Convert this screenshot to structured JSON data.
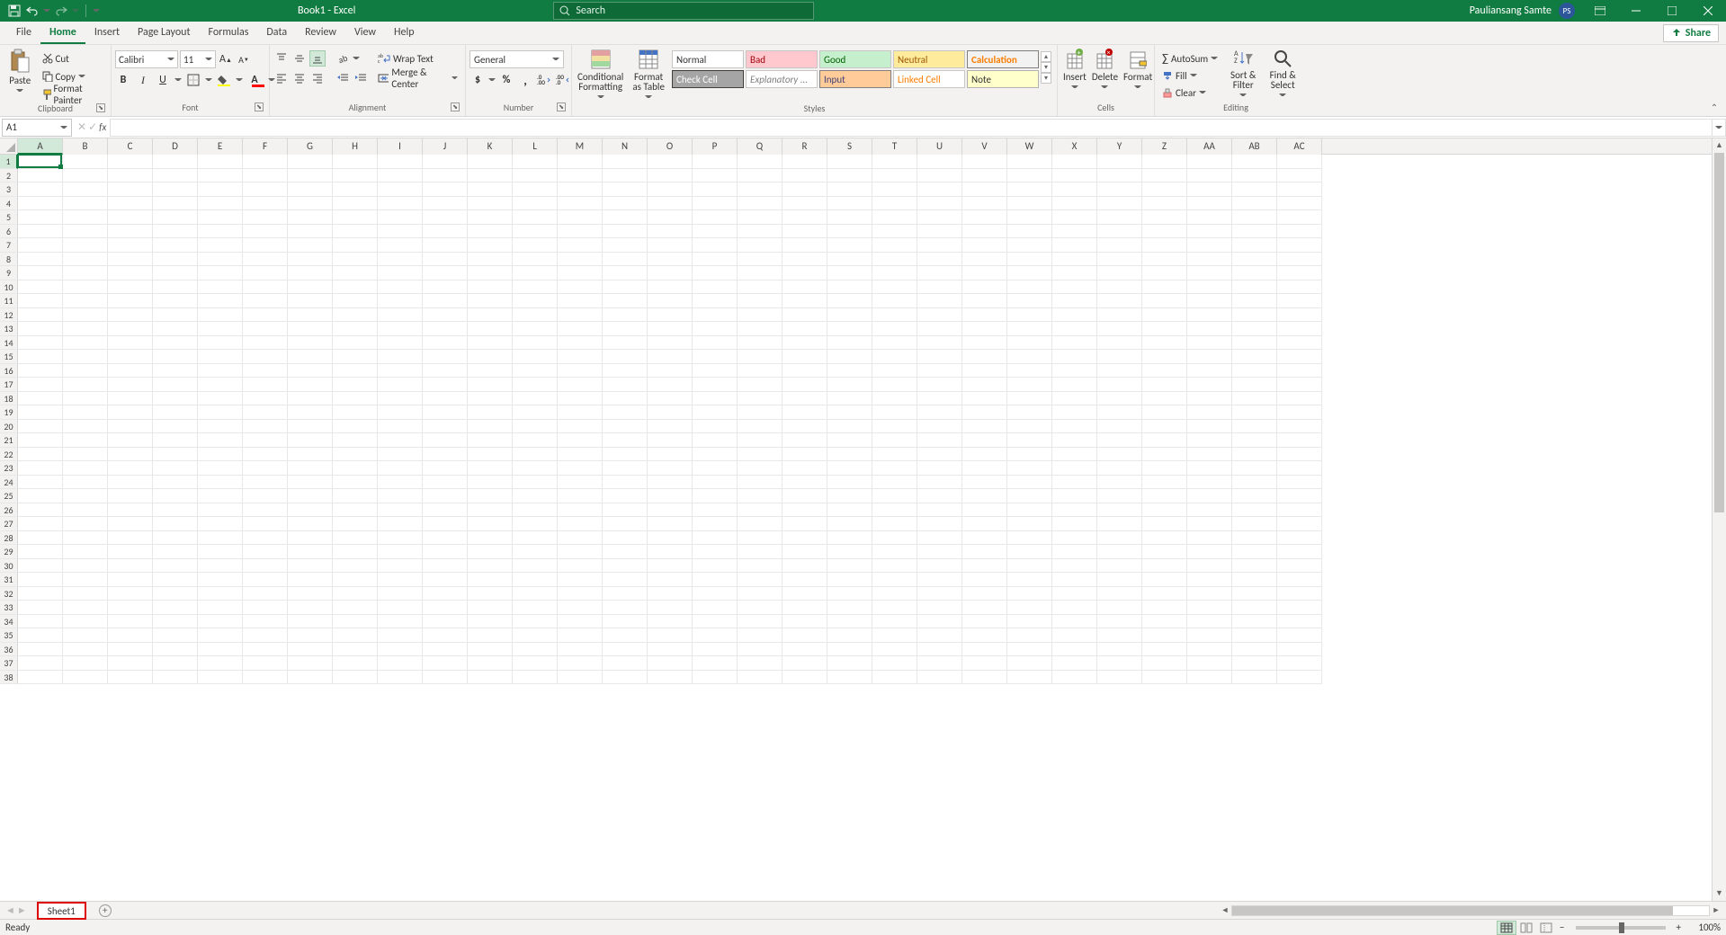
{
  "titlebar": {
    "doc_title": "Book1 - Excel",
    "search_placeholder": "Search",
    "user_name": "Pauliansang Samte",
    "user_initials": "PS"
  },
  "tabs": {
    "items": [
      "File",
      "Home",
      "Insert",
      "Page Layout",
      "Formulas",
      "Data",
      "Review",
      "View",
      "Help"
    ],
    "active": "Home",
    "share": "Share"
  },
  "clipboard": {
    "paste": "Paste",
    "cut": "Cut",
    "copy": "Copy",
    "fmtpaint": "Format Painter",
    "label": "Clipboard"
  },
  "font": {
    "name": "Calibri",
    "size": "11",
    "label": "Font"
  },
  "alignment": {
    "wrap": "Wrap Text",
    "merge": "Merge & Center",
    "label": "Alignment"
  },
  "number": {
    "format": "General",
    "label": "Number"
  },
  "styles": {
    "condfmt": "Conditional Formatting",
    "fmttable": "Format as Table",
    "cells": [
      "Normal",
      "Bad",
      "Good",
      "Neutral",
      "Calculation",
      "Check Cell",
      "Explanatory ...",
      "Input",
      "Linked Cell",
      "Note"
    ],
    "label": "Styles"
  },
  "cells": {
    "insert": "Insert",
    "delete": "Delete",
    "format": "Format",
    "label": "Cells"
  },
  "editing": {
    "autosum": "AutoSum",
    "fill": "Fill",
    "clear": "Clear",
    "sortfilter": "Sort & Filter",
    "findselect": "Find & Select",
    "label": "Editing"
  },
  "namebox": "A1",
  "columns": [
    "A",
    "B",
    "C",
    "D",
    "E",
    "F",
    "G",
    "H",
    "I",
    "J",
    "K",
    "L",
    "M",
    "N",
    "O",
    "P",
    "Q",
    "R",
    "S",
    "T",
    "U",
    "V",
    "W",
    "X",
    "Y",
    "Z",
    "AA",
    "AB",
    "AC"
  ],
  "row_count": 38,
  "active_cell": {
    "col": 0,
    "row": 0
  },
  "sheet": {
    "name": "Sheet1"
  },
  "status": {
    "ready": "Ready",
    "zoom": "100%"
  }
}
